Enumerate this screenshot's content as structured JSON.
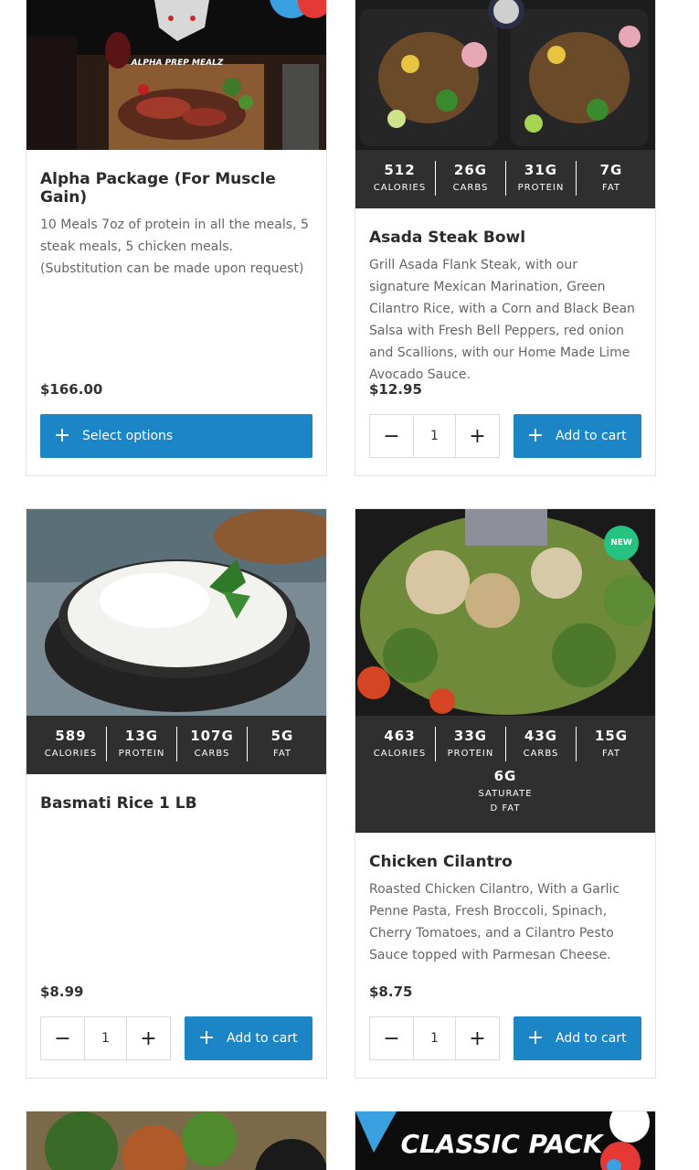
{
  "products": [
    {
      "title": "Alpha Package (For Muscle Gain)",
      "description": "10 Meals 7oz of protein in all the meals, 5 steak meals, 5 chicken meals. (Substitution can be made upon request)",
      "price": "$166.00",
      "button_label": "Select options",
      "image_logo_text": "ALPHA PREP MEALZ"
    },
    {
      "title": "Asada Steak Bowl",
      "description": "Grill Asada Flank Steak, with our signature Mexican Marination, Green Cilantro Rice, with a Corn and Black Bean Salsa with Fresh Bell Peppers, red onion and Scallions, with our Home Made Lime Avocado Sauce.",
      "price": "$12.95",
      "quantity": "1",
      "button_label": "Add to cart",
      "nutrition": [
        {
          "value": "512",
          "label": "CALORIES"
        },
        {
          "value": "26G",
          "label": "CARBS"
        },
        {
          "value": "31G",
          "label": "PROTEIN"
        },
        {
          "value": "7G",
          "label": "FAT"
        }
      ]
    },
    {
      "title": "Basmati Rice 1 LB",
      "description": "",
      "price": "$8.99",
      "quantity": "1",
      "button_label": "Add to cart",
      "nutrition": [
        {
          "value": "589",
          "label": "CALORIES"
        },
        {
          "value": "13G",
          "label": "PROTEIN"
        },
        {
          "value": "107G",
          "label": "CARBS"
        },
        {
          "value": "5G",
          "label": "FAT"
        }
      ]
    },
    {
      "title": "Chicken Cilantro",
      "description": "Roasted Chicken Cilantro, With a Garlic Penne Pasta, Fresh Broccoli, Spinach, Cherry Tomatoes, and a Cilantro Pesto Sauce topped with Parmesan Cheese.",
      "price": "$8.75",
      "quantity": "1",
      "button_label": "Add to cart",
      "badge": "NEW",
      "nutrition": [
        {
          "value": "463",
          "label": "CALORIES"
        },
        {
          "value": "33G",
          "label": "PROTEIN"
        },
        {
          "value": "43G",
          "label": "CARBS"
        },
        {
          "value": "15G",
          "label": "FAT"
        }
      ],
      "nutrition_extra": {
        "value": "6G",
        "label_line1": "SATURATE",
        "label_line2": "D FAT"
      }
    },
    {
      "image_banner_text": "CLASSIC PACK"
    }
  ],
  "colors": {
    "accent": "#1b85c6",
    "nutrition_bg": "#2f2f2f",
    "badge": "#26c281"
  },
  "icons": {
    "plus": "plus-icon",
    "minus": "minus-icon"
  }
}
